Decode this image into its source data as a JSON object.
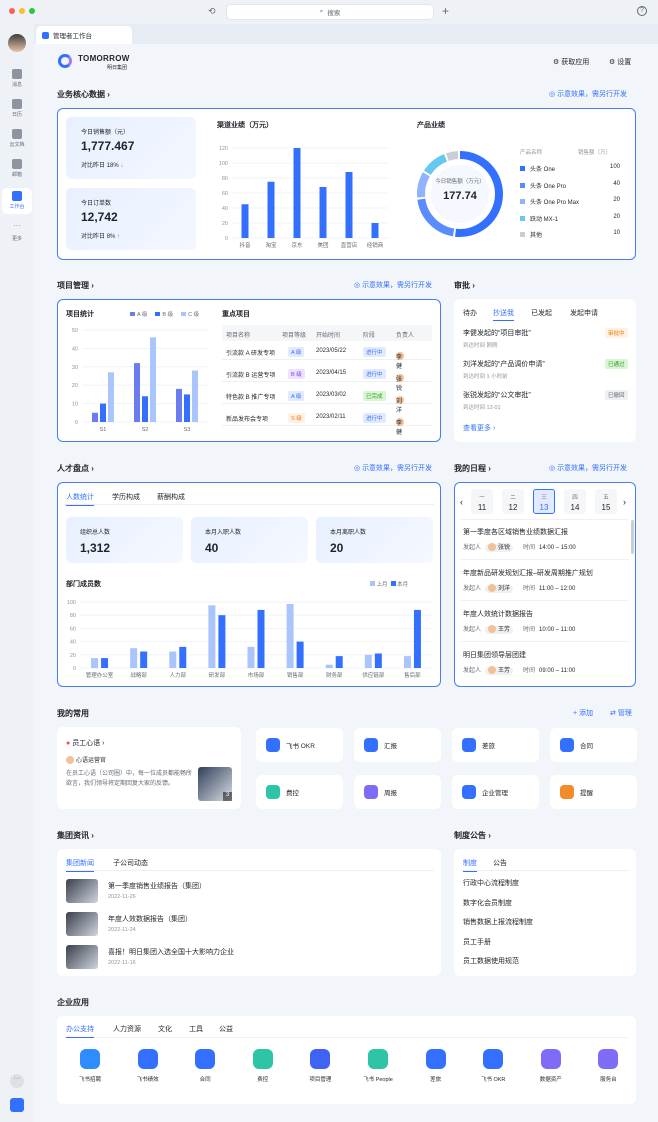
{
  "search": {
    "placeholder": "搜索"
  },
  "rail": {
    "items": [
      {
        "label": "消息"
      },
      {
        "label": "日历"
      },
      {
        "label": "云文档"
      },
      {
        "label": "邮箱"
      },
      {
        "label": "工作台"
      },
      {
        "label": "更多"
      }
    ]
  },
  "tab": {
    "title": "管理者工作台"
  },
  "brand": {
    "name": "TOMORROW",
    "sub": "明日集团"
  },
  "header": {
    "get_app": "获取应用",
    "settings": "设置"
  },
  "demo_hint": "示意效果，需另行开发",
  "core": {
    "title": "业务核心数据",
    "sales_today": {
      "label": "今日销售额（元）",
      "value": "1,777.467",
      "compare_label": "对比昨日",
      "compare": "18%"
    },
    "orders_today": {
      "label": "今日订单数",
      "value": "12,742",
      "compare_label": "对比昨日",
      "compare": "8%"
    },
    "channel_title": "渠道业绩（万元）",
    "product_title": "产品业绩",
    "donut_label": "今日销售额（万元）",
    "donut_value": "177.74",
    "product_cols": [
      "产品名称",
      "销售额（万）"
    ],
    "products": [
      {
        "name": "头条 One",
        "value": "100",
        "color": "#3370ff"
      },
      {
        "name": "头条 One Pro",
        "value": "40",
        "color": "#5a8cff"
      },
      {
        "name": "头条 One Pro Max",
        "value": "20",
        "color": "#8fb3ff"
      },
      {
        "name": "跃动 MX-1",
        "value": "20",
        "color": "#66c7f0"
      },
      {
        "name": "其他",
        "value": "10",
        "color": "#c9ced6"
      }
    ]
  },
  "project": {
    "title": "项目管理",
    "stats_title": "项目统计",
    "legend": [
      "A 级",
      "B 级",
      "C 级"
    ],
    "key_title": "重点项目",
    "cols": [
      "项目名称",
      "项目等级",
      "开始时间",
      "阶段",
      "负责人"
    ],
    "rows": [
      {
        "name": "引流款 A 研发专项",
        "level": "A 级",
        "date": "2023/05/22",
        "stage": "进行中",
        "owner": "李健"
      },
      {
        "name": "引流款 B 运营专项",
        "level": "B 级",
        "date": "2023/04/15",
        "stage": "进行中",
        "owner": "张锐"
      },
      {
        "name": "特色款 B 推广专项",
        "level": "A 级",
        "date": "2023/03/02",
        "stage": "已完成",
        "owner": "刘洋"
      },
      {
        "name": "新品发布会专项",
        "level": "S 级",
        "date": "2023/02/11",
        "stage": "进行中",
        "owner": "李健"
      }
    ]
  },
  "approval": {
    "title": "审批",
    "tabs": [
      "待办",
      "抄送我",
      "已发起",
      "发起申请"
    ],
    "items": [
      {
        "title": "李健发起的“项目审批”",
        "sub": "到达时间 刚刚",
        "status": "审批中"
      },
      {
        "title": "刘洋发起的“产品调价申请”",
        "sub": "到达时间 1 小时前",
        "status": "已通过"
      },
      {
        "title": "张锐发起的“公文审批”",
        "sub": "到达时间 12-01",
        "status": "已撤回"
      }
    ],
    "more": "查看更多"
  },
  "talent": {
    "title": "人才盘点",
    "tabs": [
      "人数统计",
      "学历构成",
      "薪酬构成"
    ],
    "stats": [
      {
        "label": "组织总人数",
        "value": "1,312"
      },
      {
        "label": "本月入职人数",
        "value": "40"
      },
      {
        "label": "本月离职人数",
        "value": "20"
      }
    ],
    "dept_title": "部门成员数",
    "legend": [
      "上月",
      "本月"
    ]
  },
  "schedule": {
    "title": "我的日程",
    "days": [
      {
        "w": "一",
        "d": "11"
      },
      {
        "w": "二",
        "d": "12"
      },
      {
        "w": "三",
        "d": "13"
      },
      {
        "w": "四",
        "d": "14"
      },
      {
        "w": "五",
        "d": "15"
      }
    ],
    "events": [
      {
        "title": "第一季度各区域销售业绩数据汇报",
        "owner": "张锐",
        "time": "14:00 – 15:00"
      },
      {
        "title": "年度新品研发规划汇报–研发周期推广规划",
        "owner": "刘洋",
        "time": "11:00 – 12:00"
      },
      {
        "title": "年度人效统计数据报告",
        "owner": "王芳",
        "time": "10:00 – 11:00"
      },
      {
        "title": "明日集团领导层团建",
        "owner": "王芳",
        "time": "09:00 – 11:00"
      }
    ],
    "owner_label": "发起人",
    "time_label": "时间"
  },
  "common": {
    "title": "我的常用",
    "add": "添加",
    "manage": "管理",
    "feature": {
      "name": "员工心语",
      "author": "心语运营官",
      "text": "在员工心语（公司圈）中，每一位成员都能畅所欲言，我们领导将定期回复大家的反馈。",
      "count": "3"
    },
    "items": [
      {
        "label": "飞书 OKR",
        "color": "#3370ff"
      },
      {
        "label": "汇报",
        "color": "#3370ff"
      },
      {
        "label": "差旅",
        "color": "#3370ff"
      },
      {
        "label": "合同",
        "color": "#3370ff"
      },
      {
        "label": "费控",
        "color": "#2ec4a8"
      },
      {
        "label": "周报",
        "color": "#7f6cf6"
      },
      {
        "label": "企业管理",
        "color": "#3370ff"
      },
      {
        "label": "提醒",
        "color": "#f58a2c"
      }
    ]
  },
  "news": {
    "title": "集团资讯",
    "tabs": [
      "集团新闻",
      "子公司动态"
    ],
    "items": [
      {
        "title": "第一季度销售业绩报告（集团）",
        "date": "2022-11-26"
      },
      {
        "title": "年度人效数据报告（集团）",
        "date": "2022-11-24"
      },
      {
        "title": "喜报！明日集团入选全国十大影响力企业",
        "date": "2022-11-16"
      }
    ]
  },
  "notice": {
    "title": "制度公告",
    "tabs": [
      "制度",
      "公告"
    ],
    "items": [
      "行政中心流程制度",
      "数字化会员制度",
      "销售数据上报流程制度",
      "员工手册",
      "员工数据使用规范"
    ]
  },
  "apps": {
    "title": "企业应用",
    "tabs": [
      "办公支持",
      "人力资源",
      "文化",
      "工具",
      "公益"
    ],
    "items": [
      {
        "label": "飞书招聘",
        "color": "#2f8cff"
      },
      {
        "label": "飞书绩效",
        "color": "#3370ff"
      },
      {
        "label": "合同",
        "color": "#3370ff"
      },
      {
        "label": "费控",
        "color": "#2ec4a8"
      },
      {
        "label": "项目管理",
        "color": "#3f63f5"
      },
      {
        "label": "飞书 People",
        "color": "#2ec4a8"
      },
      {
        "label": "差旅",
        "color": "#3370ff"
      },
      {
        "label": "飞书 OKR",
        "color": "#3370ff"
      },
      {
        "label": "数据资产",
        "color": "#7f6cf6"
      },
      {
        "label": "服务台",
        "color": "#7f6cf6"
      }
    ]
  },
  "chart_data": [
    {
      "type": "bar",
      "title": "渠道业绩（万元）",
      "categories": [
        "抖音",
        "淘宝",
        "京东",
        "美团",
        "直营店",
        "经销商"
      ],
      "values": [
        45,
        75,
        120,
        68,
        88,
        20
      ],
      "ylim": [
        0,
        120
      ],
      "yticks": [
        0,
        20,
        40,
        60,
        80,
        100,
        120
      ]
    },
    {
      "type": "pie",
      "title": "产品业绩",
      "labels": [
        "头条 One",
        "头条 One Pro",
        "头条 One Pro Max",
        "跃动 MX-1",
        "其他"
      ],
      "values": [
        100,
        40,
        20,
        20,
        10
      ]
    },
    {
      "type": "bar",
      "title": "项目统计",
      "categories": [
        "S1",
        "S2",
        "S3"
      ],
      "series": [
        {
          "name": "A 级",
          "values": [
            5,
            32,
            18
          ]
        },
        {
          "name": "B 级",
          "values": [
            10,
            14,
            15
          ]
        },
        {
          "name": "C 级",
          "values": [
            27,
            46,
            28
          ]
        }
      ],
      "ylim": [
        0,
        50
      ],
      "yticks": [
        0,
        10,
        20,
        30,
        40,
        50
      ]
    },
    {
      "type": "bar",
      "title": "部门成员数",
      "categories": [
        "管理办公室",
        "战略部",
        "人力部",
        "研发部",
        "市场部",
        "销售部",
        "财务部",
        "供应链部",
        "售后部"
      ],
      "series": [
        {
          "name": "上月",
          "values": [
            15,
            30,
            25,
            95,
            32,
            97,
            5,
            20,
            18
          ]
        },
        {
          "name": "本月",
          "values": [
            15,
            25,
            32,
            80,
            88,
            40,
            18,
            22,
            88
          ]
        }
      ],
      "ylim": [
        0,
        100
      ],
      "yticks": [
        0,
        20,
        40,
        60,
        80,
        100
      ]
    }
  ]
}
